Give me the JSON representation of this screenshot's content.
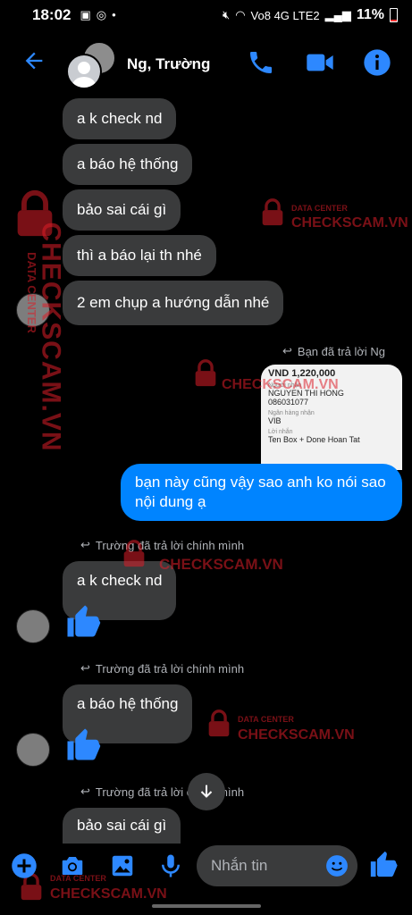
{
  "status": {
    "time": "18:02",
    "battery": "11%",
    "network": "Vo8 4G LTE2"
  },
  "header": {
    "title": "Ng, Trường"
  },
  "messages": [
    {
      "text": "a k check nd"
    },
    {
      "text": "a báo hệ thống"
    },
    {
      "text": "bảo sai cái gì"
    },
    {
      "text": "thì a báo lại th nhé"
    },
    {
      "text": "2 em chụp a hướng dẫn nhé"
    }
  ],
  "reply_notes": {
    "me_replied": "Bạn đã trả lời Ng",
    "truong_replied_1": "Trường đã trả lời chính mình",
    "truong_replied_2": "Trường đã trả lời chính mình",
    "truong_replied_3": "Trường đã trả lời chính mình"
  },
  "receipt": {
    "amount": "VND 1,220,000",
    "receiver_label": "Người nhận",
    "receiver_name": "NGUYEN THI HONG",
    "account": "086031077",
    "bank_label": "Ngân hàng nhận",
    "bank": "VIB",
    "note_label": "Lời nhắn",
    "note": "Ten Box + Done Hoan Tat"
  },
  "my_message": {
    "line1": "bạn này cũng vậy sao anh ko nói sao",
    "line2": "nội dung ạ"
  },
  "quoted": {
    "q1": "a k check nd",
    "q2": "a báo hệ thống",
    "q3": "bảo sai cái gì"
  },
  "composer": {
    "placeholder": "Nhắn tin"
  },
  "watermark": {
    "top": "DATA CENTER",
    "brand": "CHECKSCAM.VN"
  },
  "colors": {
    "accent": "#0084ff",
    "bubble_other": "#3a3b3c",
    "watermark": "#dc1e28"
  }
}
